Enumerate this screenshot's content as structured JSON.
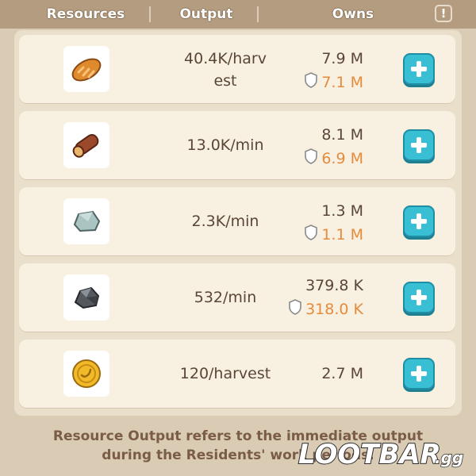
{
  "header": {
    "col_resources": "Resources",
    "col_output": "Output",
    "col_owns": "Owns",
    "info_glyph": "!"
  },
  "rows": [
    {
      "icon": "bread-icon",
      "output_line1": "40.4K/harv",
      "output_line2": "est",
      "owned": "7.9 M",
      "protected": "7.1 M"
    },
    {
      "icon": "wood-log-icon",
      "output_line1": "13.0K/min",
      "output_line2": "",
      "owned": "8.1 M",
      "protected": "6.9 M"
    },
    {
      "icon": "stone-icon",
      "output_line1": "2.3K/min",
      "output_line2": "",
      "owned": "1.3 M",
      "protected": "1.1 M"
    },
    {
      "icon": "iron-ore-icon",
      "output_line1": "532/min",
      "output_line2": "",
      "owned": "379.8 K",
      "protected": "318.0 K"
    },
    {
      "icon": "gold-coin-icon",
      "output_line1": "120/harvest",
      "output_line2": "",
      "owned": "2.7 M",
      "protected": ""
    }
  ],
  "footer": {
    "line1": "Resource Output refers to the immediate output",
    "line2": "during the Residents' work periods."
  },
  "watermark": {
    "brand": "LOOTBAR",
    "suffix": ".gg"
  },
  "colors": {
    "accent_button": "#38bfd4",
    "protected_text": "#e58b3c",
    "text": "#5a4636"
  }
}
